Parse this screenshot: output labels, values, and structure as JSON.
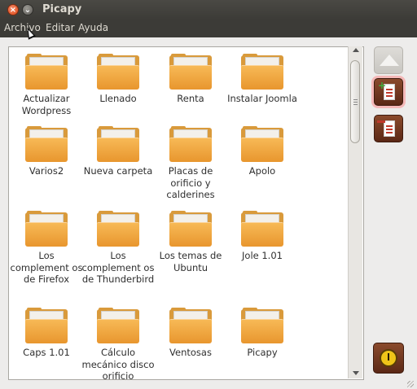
{
  "window": {
    "title": "Picapy"
  },
  "menu": [
    "Archivo",
    "Editar",
    "Ayuda"
  ],
  "folders": [
    {
      "label": "Actualizar Wordpress"
    },
    {
      "label": "Llenado"
    },
    {
      "label": "Renta"
    },
    {
      "label": "Instalar Joomla"
    },
    {
      "label": "Varios2"
    },
    {
      "label": "Nueva carpeta"
    },
    {
      "label": "Placas de orificio y calderines"
    },
    {
      "label": "Apolo"
    },
    {
      "label": "Los complement os de Firefox"
    },
    {
      "label": "Los complement os de Thunderbird"
    },
    {
      "label": "Los temas de Ubuntu"
    },
    {
      "label": "Jole 1.01"
    },
    {
      "label": "Caps 1.01"
    },
    {
      "label": "Cálculo mecánico disco orificio"
    },
    {
      "label": "Ventosas"
    },
    {
      "label": "Picapy"
    }
  ],
  "icons": {
    "close": "close-icon",
    "minimize": "minimize-icon",
    "folder": "folder-icon",
    "up": "up-arrow-icon",
    "add": "add-document-icon",
    "remove": "remove-document-icon",
    "power": "power-icon"
  },
  "colors": {
    "accent_orange": "#e8962e",
    "button_brown": "#6b3520",
    "power_yellow": "#f0c419"
  }
}
